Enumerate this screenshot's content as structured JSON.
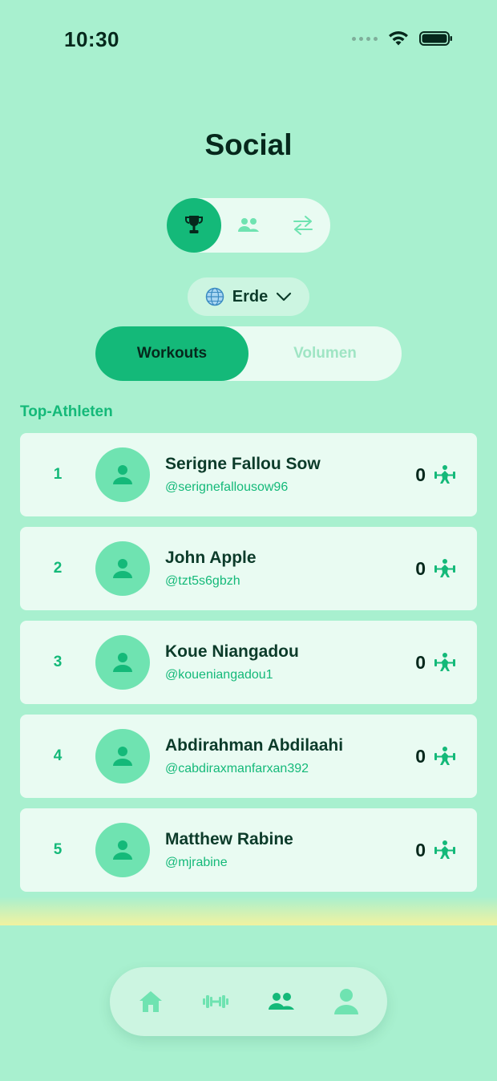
{
  "status_bar": {
    "time": "10:30"
  },
  "title": "Social",
  "mode_switch": {
    "items": [
      {
        "icon": "trophy-icon",
        "active": true
      },
      {
        "icon": "friends-icon",
        "active": false
      },
      {
        "icon": "swap-icon",
        "active": false
      }
    ]
  },
  "region": {
    "label": "Erde",
    "icon": "globe-icon"
  },
  "tabs": [
    {
      "label": "Workouts",
      "active": true
    },
    {
      "label": "Volumen",
      "active": false
    }
  ],
  "section_label": "Top-Athleten",
  "athletes": [
    {
      "rank": "1",
      "name": "Serigne Fallou Sow",
      "handle": "@serignefallousow96",
      "score": "0"
    },
    {
      "rank": "2",
      "name": "John Apple",
      "handle": "@tzt5s6gbzh",
      "score": "0"
    },
    {
      "rank": "3",
      "name": "Koue Niangadou",
      "handle": "@koueniangadou1",
      "score": "0"
    },
    {
      "rank": "4",
      "name": "Abdirahman Abdilaahi",
      "handle": "@cabdiraxmanfarxan392",
      "score": "0"
    },
    {
      "rank": "5",
      "name": "Matthew Rabine",
      "handle": "@mjrabine",
      "score": "0"
    }
  ],
  "bottom_nav": [
    {
      "icon": "home-icon",
      "active": false
    },
    {
      "icon": "dumbbell-icon",
      "active": false
    },
    {
      "icon": "social-icon",
      "active": true
    },
    {
      "icon": "profile-icon",
      "active": false
    }
  ],
  "colors": {
    "background": "#a8f0cf",
    "accent": "#14b979",
    "card": "#e9fbf2",
    "text_dark": "#0c3b2a"
  }
}
